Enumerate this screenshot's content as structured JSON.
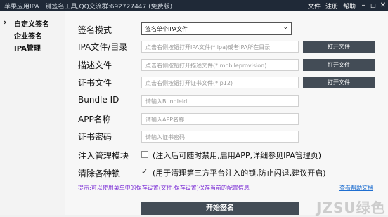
{
  "window": {
    "title": "苹果应用IPA一键签名工具,QQ交流群:692727447 (免费版)",
    "menu": [
      "文件",
      "注册",
      "帮助"
    ],
    "controls": [
      "–",
      "□",
      "✕"
    ]
  },
  "sidebar": {
    "items": [
      {
        "label": "自定义签名",
        "active": true
      },
      {
        "label": "企业签名"
      },
      {
        "label": "IPA管理"
      }
    ],
    "arrow": "›"
  },
  "form": {
    "sign_mode": {
      "label": "签名模式",
      "value": "签名单个IPA文件",
      "chevron": "⌄"
    },
    "ipa": {
      "label": "IPA文件/目录",
      "placeholder": "点击右侧按钮打开IPA文件(*.ipa)或者IPA所在目录",
      "button": "打开文件"
    },
    "profile": {
      "label": "描述文件",
      "placeholder": "点击右侧按钮打开描述文件(*.mobileprovision)",
      "button": "打开文件"
    },
    "cert": {
      "label": "证书文件",
      "placeholder": "点击右侧按钮打开证书文件(*.p12)",
      "button": "打开文件"
    },
    "bundle_id": {
      "label": "Bundle ID",
      "placeholder": "请输入BundleId"
    },
    "app_name": {
      "label": "APP名称",
      "placeholder": "请输入APP名称"
    },
    "cert_pwd": {
      "label": "证书密码",
      "placeholder": "请输入证书密码"
    },
    "inject": {
      "label": "注入管理模块",
      "checked": false,
      "text": "(注入后可随时禁用,启用APP,详细参见IPA管理页)"
    },
    "clear_locks": {
      "label": "清除各种锁",
      "checked": true,
      "check_glyph": "✓",
      "text": "(用于清理第三方平台注入的锁,防止闪退,建议开启)"
    }
  },
  "tip": "提示:可以使用菜单中的保存设置(文件-保存设置)保存当前的配置信息",
  "help_link": "查看帮助文档",
  "start_button": "开始签名",
  "watermark": "JZSU绿色"
}
